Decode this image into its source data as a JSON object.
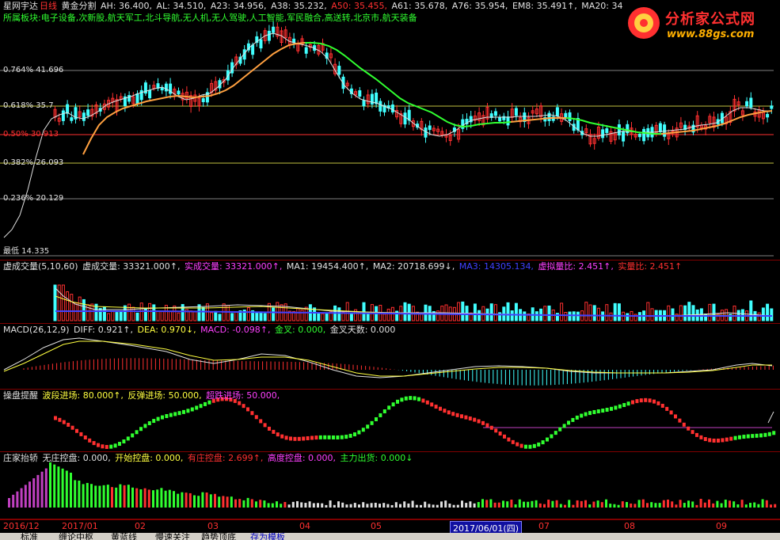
{
  "main_header": {
    "app": "星网宇达",
    "period": "日线",
    "indicator": "黄金分割",
    "ah": "AH: 36.400,",
    "al": "AL: 34.510,",
    "a23": "A23: 34.956,",
    "a38": "A38: 35.232,",
    "a50": "A50: 35.455,",
    "a61": "A61: 35.678,",
    "a76": "A76: 35.954,",
    "em8": "EM8: 35.491↑,",
    "ma20": "MA20: 34"
  },
  "sector": "所属板块:电子设备,次新股,航天军工,北斗导航,无人机,无人驾驶,人工智能,军民融合,高送转,北京市,航天装备",
  "fib_labels": [
    "0.764% 41.696",
    "0.618% 35.7",
    "0.50% 30.913",
    "0.382% 26.093",
    "0.236% 20.129",
    "最低 14.335"
  ],
  "volume_header": {
    "name": "虚成交量(5,10,60)",
    "v1": "虚成交量: 33321.000↑,",
    "v2": "实成交量: 33321.000↑,",
    "ma1": "MA1: 19454.400↑,",
    "ma2": "MA2: 20718.699↓,",
    "ma3": "MA3: 14305.134,",
    "ratio1": "虚拟量比: 2.451↑,",
    "ratio2": "实量比: 2.451↑"
  },
  "macd_header": {
    "name": "MACD(26,12,9)",
    "diff": "DIFF: 0.921↑,",
    "dea": "DEA: 0.970↓,",
    "macd": "MACD: -0.098↑,",
    "gold": "金叉: 0.000,",
    "days": "金叉天数: 0.000"
  },
  "cp_header": {
    "name": "操盘提醒",
    "wave": "波段进场: 80.000↑,",
    "rebound": "反弹进场: 50.000,",
    "oversold": "超跌进场: 50.000,"
  },
  "zj_header": {
    "name": "庄家抬轿",
    "none": "无庄控盘: 0.000,",
    "start": "开始控盘: 0.000,",
    "has": "有庄控盘: 2.699↑,",
    "high": "高度控盘: 0.000,",
    "out": "主力出货: 0.000↓"
  },
  "time_axis": [
    "2016/12",
    "2017/01",
    "02",
    "03",
    "04",
    "05",
    "07",
    "08",
    "09"
  ],
  "selected_date": "2017/06/01(四)",
  "bottom_tabs": [
    "标准",
    "缠论中枢",
    "黄蓝线",
    "慢速关注",
    "趋势顶底",
    "存为模板"
  ],
  "logo": {
    "title": "分析家公式网",
    "url": "www.88gs.com"
  },
  "colors": {
    "up": "#ff3030",
    "down": "#40ffff",
    "ma_orange": "#ffa040",
    "ma_green": "#30ff30",
    "bg": "#000000"
  }
}
